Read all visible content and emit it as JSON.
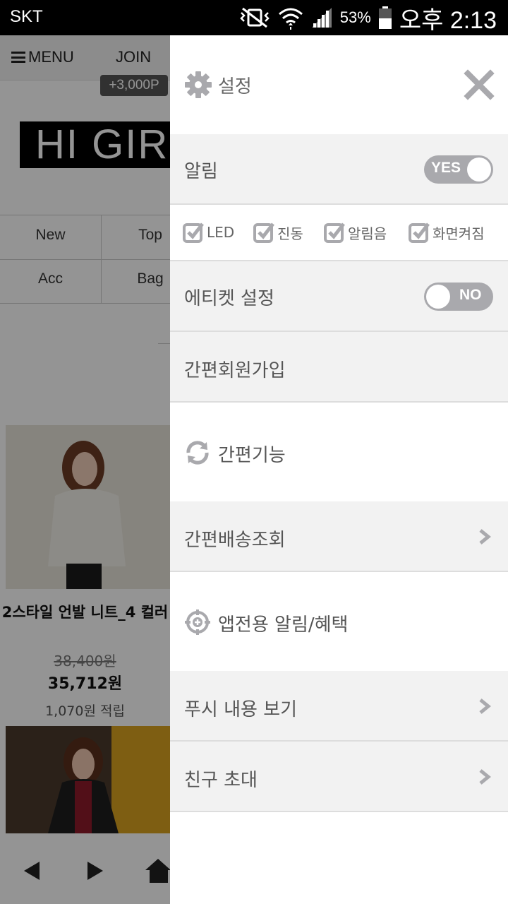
{
  "status_bar": {
    "carrier": "SKT",
    "battery_pct": "53%",
    "time": "오후 2:13",
    "icons": [
      "mute-vibrate-icon",
      "wifi-icon",
      "signal-icon",
      "battery-icon"
    ]
  },
  "background_page": {
    "menu_label": "MENU",
    "join_label": "JOIN",
    "join_points": "+3,000P",
    "logo_text": "HI GIRL",
    "categories": [
      "New",
      "Top",
      "Acc",
      "Bag"
    ],
    "product": {
      "name": "2스타일 언발 니트_4 컬러",
      "old_price": "38,400원",
      "price": "35,712원",
      "points": "1,070원 적립"
    }
  },
  "drawer": {
    "title": "설정",
    "notification": {
      "label": "알림",
      "toggle_label": "YES",
      "on": true
    },
    "checkboxes": [
      {
        "label": "LED",
        "checked": true
      },
      {
        "label": "진동",
        "checked": true
      },
      {
        "label": "알림음",
        "checked": true
      },
      {
        "label": "화면켜짐",
        "checked": true
      }
    ],
    "etiquette": {
      "label": "에티켓 설정",
      "toggle_label": "NO",
      "on": false
    },
    "easy_signup": "간편회원가입",
    "easy_features": "간편기능",
    "shipping_lookup": "간편배송조회",
    "app_benefits": "앱전용 알림/혜택",
    "push_view": "푸시 내용 보기",
    "invite_friends": "친구 초대"
  },
  "colors": {
    "toggle": "#a9a9ad",
    "row_grey": "#f2f2f2",
    "text": "#555555",
    "overlay": "rgba(0,0,0,0.42)"
  }
}
